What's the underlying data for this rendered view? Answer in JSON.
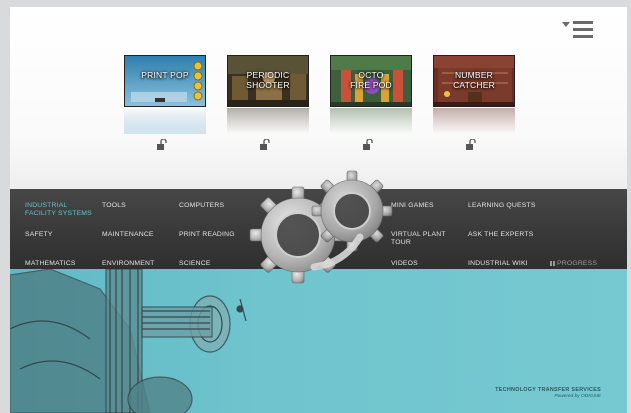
{
  "games": [
    {
      "title_line1": "PRINT POP",
      "title_line2": ""
    },
    {
      "title_line1": "PERIODIC",
      "title_line2": "SHOOTER"
    },
    {
      "title_line1": "OCTO",
      "title_line2": "FIRE POD"
    },
    {
      "title_line1": "NUMBER",
      "title_line2": "CATCHER"
    }
  ],
  "nav": {
    "industrial_line1": "INDUSTRIAL",
    "industrial_line2": "FACILITY SYSTEMS",
    "tools": "TOOLS",
    "computers": "COMPUTERS",
    "safety": "SAFETY",
    "maintenance": "MAINTENANCE",
    "print_reading": "PRINT READING",
    "mathematics": "MATHEMATICS",
    "environment": "ENVIRONMENT",
    "science": "SCIENCE",
    "mini_games": "MINI GAMES",
    "learning_quests": "LEARNING QUESTS",
    "virtual_line1": "VIRTUAL PLANT",
    "virtual_line2": "TOUR",
    "ask_experts": "ASK THE EXPERTS",
    "videos": "VIDEOS",
    "industrial_wiki": "INDUSTRIAL WIKI",
    "progress": "PROGRESS"
  },
  "brand": {
    "line1": "TECHNOLOGY TRANSFER SERVICES",
    "line2": "Powered by ODIGSIE"
  },
  "colors": {
    "accent": "#5fc6d3",
    "nav_bg": "#3a3a3a",
    "bottom_bg": "#6fc4cd"
  },
  "icons": {
    "menu": "hamburger-menu-icon",
    "lock": "unlock-icon",
    "logo": "gears-logo",
    "progress": "grid-icon"
  }
}
